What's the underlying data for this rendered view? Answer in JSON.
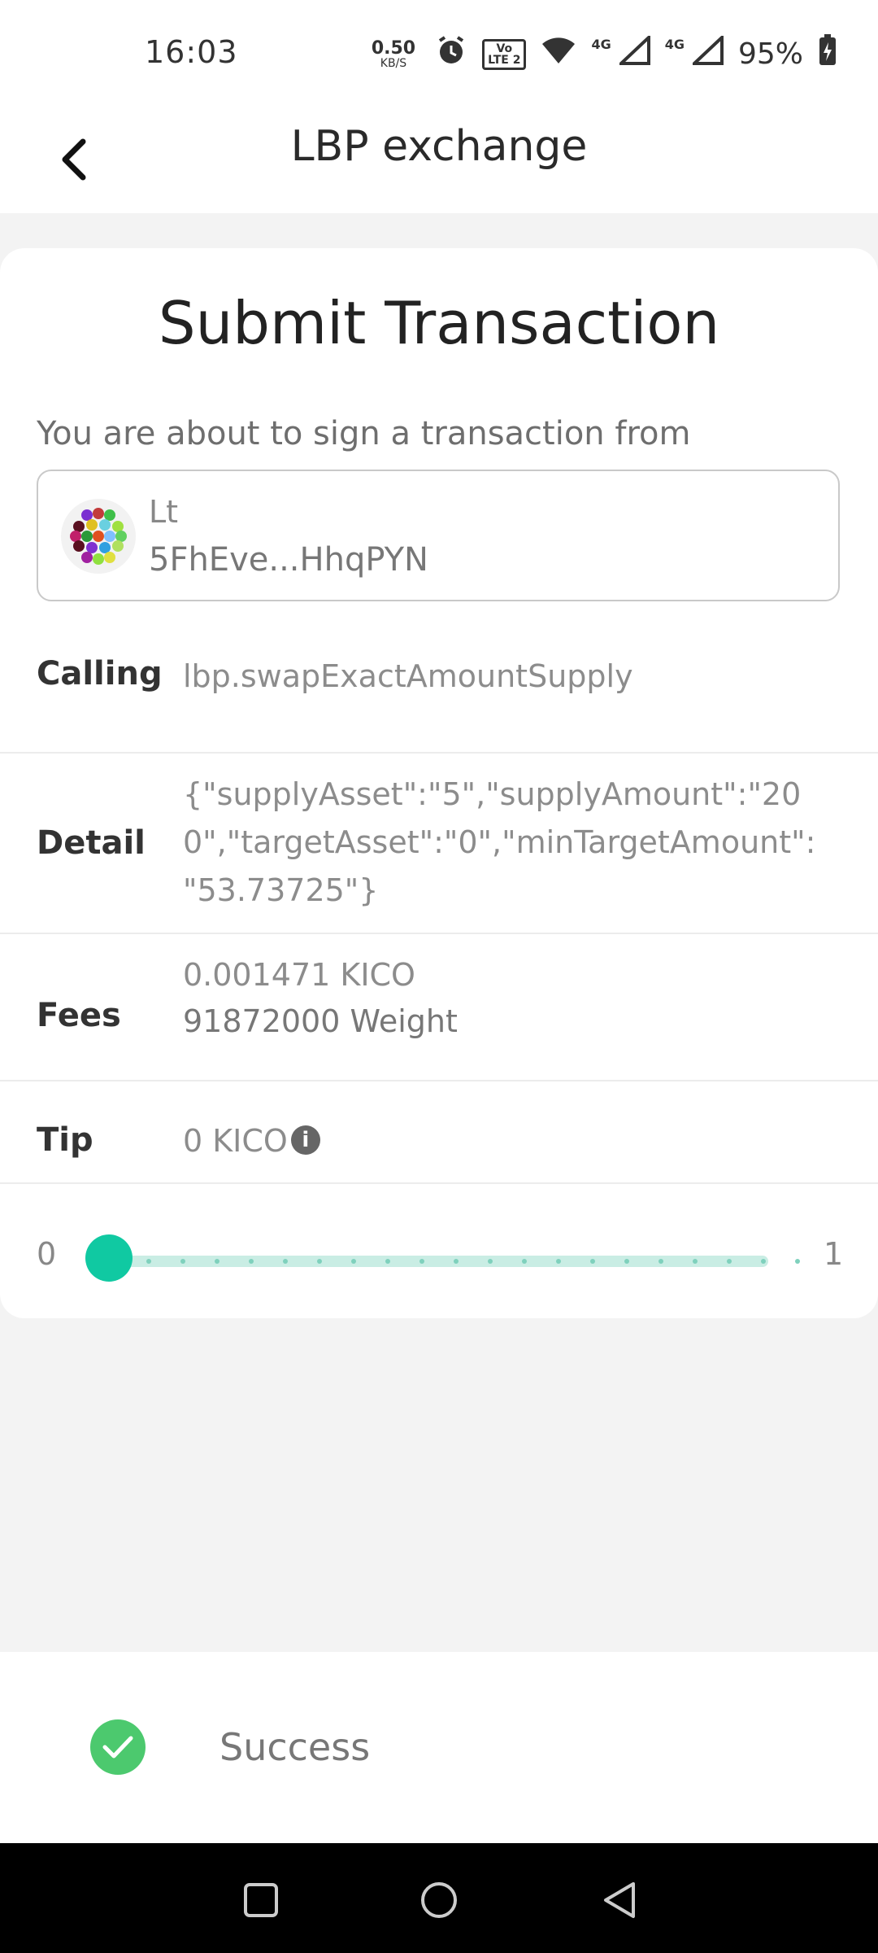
{
  "status_bar": {
    "time": "16:03",
    "net_speed_value": "0.50",
    "net_speed_unit": "KB/S",
    "volte_top": "Vo",
    "volte_bottom": "LTE 2",
    "signal1_label": "4G",
    "signal2_label": "4G",
    "battery": "95%",
    "icons": [
      "alarm-icon",
      "volte-icon",
      "wifi-icon",
      "signal-icon",
      "battery-charging-icon"
    ]
  },
  "header": {
    "title": "LBP exchange",
    "back_icon": "back-arrow-icon"
  },
  "transaction": {
    "title": "Submit Transaction",
    "sign_label": "You are about to sign a transaction from",
    "account": {
      "name": "Lt",
      "address": "5FhEve...HhqPYN"
    },
    "calling_label": "Calling",
    "calling_value": "lbp.swapExactAmountSupply",
    "detail_label": "Detail",
    "detail_lines": [
      "{\"supplyAsset\":\"5\",\"supplyAmount\":\"20",
      "0\",\"targetAsset\":\"0\",\"minTargetAmount\":",
      "\"53.73725\"}"
    ],
    "fees_label": "Fees",
    "fees_value": "0.001471 KICO",
    "fees_weight": "91872000 Weight",
    "tip_label": "Tip",
    "tip_value": "0 KICO",
    "tip_slider": {
      "min_label": "0",
      "max_label": "1",
      "value": 0,
      "accent": "#10c9a2"
    }
  },
  "toast": {
    "text": "Success",
    "icon": "check-circle-icon",
    "color": "#4cc96e"
  },
  "nav": {
    "icons": [
      "recents-square-icon",
      "home-circle-icon",
      "back-triangle-icon"
    ]
  }
}
